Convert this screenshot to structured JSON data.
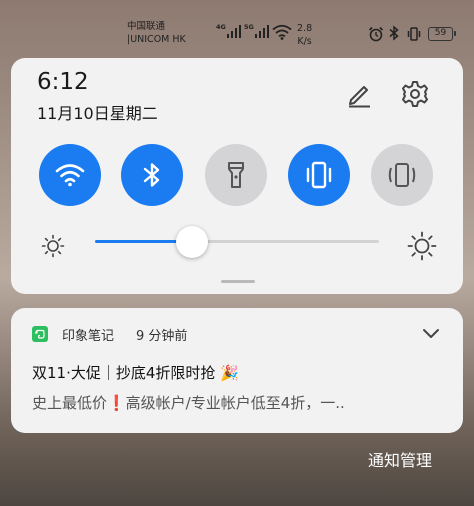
{
  "status_bar": {
    "carrier_line1": "中国联通",
    "carrier_line2": "|UNICOM HK",
    "sim1_type": "4G",
    "sim2_type": "5G",
    "speed_value": "2.8",
    "speed_unit": "K/s",
    "battery": "59",
    "icons": [
      "signal-icon",
      "wifi-icon",
      "alarm-icon",
      "bluetooth-icon",
      "vibrate-icon",
      "battery-icon"
    ]
  },
  "quick_panel": {
    "time": "6:12",
    "date": "11月10日星期二",
    "toggles": [
      {
        "name": "wifi",
        "on": true
      },
      {
        "name": "bluetooth",
        "on": true
      },
      {
        "name": "flashlight",
        "on": false
      },
      {
        "name": "vibrate",
        "on": true
      },
      {
        "name": "auto-rotate",
        "on": false
      }
    ],
    "brightness_level": 0.34
  },
  "notification": {
    "app_name": "印象笔记",
    "time": "9 分钟前",
    "title": "双11·大促｜抄底4折限时抢 🎉",
    "body": "史上最低价❗高级帐户/专业帐户低至4折，一.."
  },
  "footer": {
    "manage_label": "通知管理"
  },
  "colors": {
    "accent": "#1a7cf0",
    "toggle_off": "#d4d4d6",
    "panel_bg": "#f2f2f3",
    "evernote_green": "#2dbe60"
  }
}
